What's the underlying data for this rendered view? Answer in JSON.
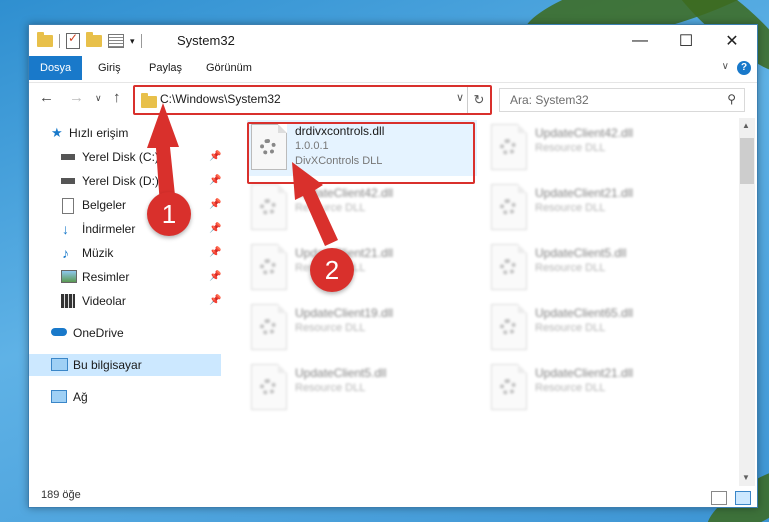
{
  "window": {
    "title": "System32"
  },
  "ribbon": {
    "tabs": [
      "Dosya",
      "Giriş",
      "Paylaş",
      "Görünüm"
    ]
  },
  "address": {
    "path": "C:\\Windows\\System32"
  },
  "search": {
    "placeholder": "Ara: System32"
  },
  "sidebar": {
    "items": [
      {
        "label": "Hızlı erişim",
        "icon": "star-icon"
      },
      {
        "label": "Yerel Disk (C:)",
        "icon": "drive-icon",
        "pinned": true
      },
      {
        "label": "Yerel Disk (D:)",
        "icon": "drive-icon",
        "pinned": true
      },
      {
        "label": "Belgeler",
        "icon": "documents-icon",
        "pinned": true
      },
      {
        "label": "İndirmeler",
        "icon": "download-icon",
        "pinned": true
      },
      {
        "label": "Müzik",
        "icon": "music-icon",
        "pinned": true
      },
      {
        "label": "Resimler",
        "icon": "pictures-icon",
        "pinned": true
      },
      {
        "label": "Videolar",
        "icon": "video-icon",
        "pinned": true
      },
      {
        "label": "OneDrive",
        "icon": "cloud-icon"
      },
      {
        "label": "Bu bilgisayar",
        "icon": "computer-icon",
        "selected": true
      },
      {
        "label": "Ağ",
        "icon": "network-icon"
      }
    ]
  },
  "files": {
    "main": {
      "name": "drdivxcontrols.dll",
      "version": "1.0.0.1",
      "description": "DivXControls DLL"
    },
    "others": [
      {
        "name": "UpdateClient42.dll",
        "type": "Resource DLL"
      },
      {
        "name": "UpdateClient42.dll",
        "type": "Resource DLL"
      },
      {
        "name": "UpdateClient21.dll",
        "type": "Resource DLL"
      },
      {
        "name": "UpdateClient21.dll",
        "type": "Resource DLL"
      },
      {
        "name": "UpdateClient5.dll",
        "type": "Resource DLL"
      },
      {
        "name": "UpdateClient19.dll",
        "type": "Resource DLL"
      },
      {
        "name": "UpdateClient65.dll",
        "type": "Resource DLL"
      },
      {
        "name": "UpdateClient5.dll",
        "type": "Resource DLL"
      },
      {
        "name": "UpdateClient21.dll",
        "type": "Resource DLL"
      }
    ]
  },
  "status": {
    "count": "189 öğe"
  },
  "annotations": {
    "step1": "1",
    "step2": "2"
  },
  "colors": {
    "accent": "#1979ca",
    "annotation": "#d9302c"
  }
}
